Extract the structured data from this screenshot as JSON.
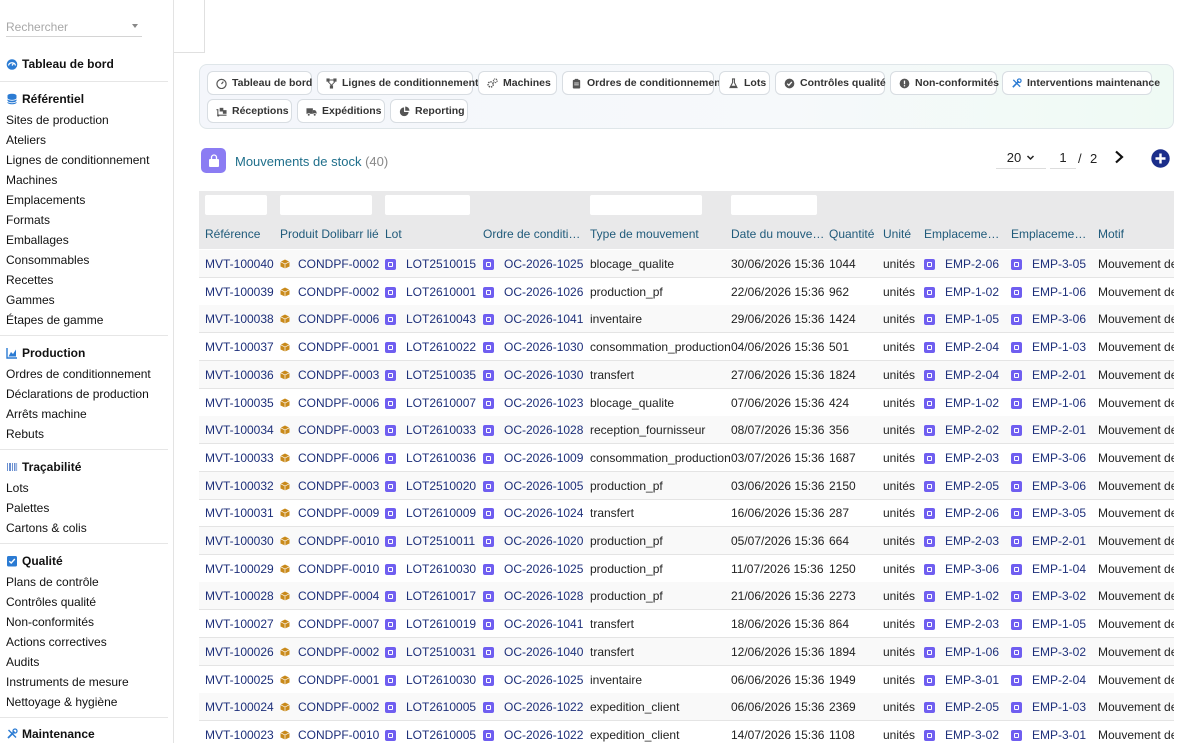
{
  "search": {
    "placeholder": "Rechercher"
  },
  "sidebar": {
    "dashboard": "Tableau de bord",
    "sections": [
      {
        "title": "Référentiel",
        "icon": "database-icon",
        "items": [
          "Sites de production",
          "Ateliers",
          "Lignes de conditionnement",
          "Machines",
          "Emplacements",
          "Formats",
          "Emballages",
          "Consommables",
          "Recettes",
          "Gammes",
          "Étapes de gamme"
        ]
      },
      {
        "title": "Production",
        "icon": "chart-icon",
        "items": [
          "Ordres de conditionnement",
          "Déclarations de production",
          "Arrêts machine",
          "Rebuts"
        ]
      },
      {
        "title": "Traçabilité",
        "icon": "barcode-icon",
        "items": [
          "Lots",
          "Palettes",
          "Cartons & colis"
        ]
      },
      {
        "title": "Qualité",
        "icon": "check-square-icon",
        "items": [
          "Plans de contrôle",
          "Contrôles qualité",
          "Non-conformités",
          "Actions correctives",
          "Audits",
          "Instruments de mesure",
          "Nettoyage & hygiène"
        ]
      },
      {
        "title": "Maintenance",
        "icon": "tools-icon",
        "items": []
      }
    ]
  },
  "tabs": [
    {
      "label": "Tableau de bord",
      "icon": "dashboard-icon"
    },
    {
      "label": "Lignes de conditionnement",
      "icon": "network-icon"
    },
    {
      "label": "Machines",
      "icon": "cogs-icon"
    },
    {
      "label": "Ordres de conditionnement",
      "icon": "clipboard-icon"
    },
    {
      "label": "Lots",
      "icon": "flask-icon"
    },
    {
      "label": "Contrôles qualité",
      "icon": "check-circle-icon"
    },
    {
      "label": "Non-conformités",
      "icon": "exclamation-circle-icon"
    },
    {
      "label": "Interventions maintenance",
      "icon": "tools-icon"
    },
    {
      "label": "Réceptions",
      "icon": "dolly-icon"
    },
    {
      "label": "Expéditions",
      "icon": "truck-icon"
    },
    {
      "label": "Reporting",
      "icon": "pie-chart-icon"
    }
  ],
  "list": {
    "title": "Mouvements de stock",
    "count": "(40)",
    "page_size": "20",
    "page": "1",
    "page_sep": "/",
    "page_total": "2"
  },
  "table": {
    "columns": [
      "Référence",
      "Produit Dolibarr lié",
      "Lot",
      "Ordre de conditi…",
      "Type de mouvement",
      "Date du mouve…",
      "Quantité",
      "Unité",
      "Emplaceme…",
      "Emplaceme…",
      "Motif"
    ],
    "rows": [
      [
        "MVT-100040",
        "CONDPF-0002",
        "LOT2510015",
        "OC-2026-1025",
        "blocage_qualite",
        "30/06/2026 15:36",
        "1044",
        "unités",
        "EMP-2-06",
        "EMP-3-05",
        "Mouvement de"
      ],
      [
        "MVT-100039",
        "CONDPF-0002",
        "LOT2610001",
        "OC-2026-1026",
        "production_pf",
        "22/06/2026 15:36",
        "962",
        "unités",
        "EMP-1-02",
        "EMP-1-06",
        "Mouvement de"
      ],
      [
        "MVT-100038",
        "CONDPF-0006",
        "LOT2610043",
        "OC-2026-1041",
        "inventaire",
        "29/06/2026 15:36",
        "1424",
        "unités",
        "EMP-1-05",
        "EMP-3-06",
        "Mouvement de"
      ],
      [
        "MVT-100037",
        "CONDPF-0001",
        "LOT2610022",
        "OC-2026-1030",
        "consommation_production",
        "04/06/2026 15:36",
        "501",
        "unités",
        "EMP-2-04",
        "EMP-1-03",
        "Mouvement de"
      ],
      [
        "MVT-100036",
        "CONDPF-0003",
        "LOT2510035",
        "OC-2026-1030",
        "transfert",
        "27/06/2026 15:36",
        "1824",
        "unités",
        "EMP-2-04",
        "EMP-2-01",
        "Mouvement de"
      ],
      [
        "MVT-100035",
        "CONDPF-0006",
        "LOT2610007",
        "OC-2026-1023",
        "blocage_qualite",
        "07/06/2026 15:36",
        "424",
        "unités",
        "EMP-1-02",
        "EMP-1-06",
        "Mouvement de"
      ],
      [
        "MVT-100034",
        "CONDPF-0003",
        "LOT2610033",
        "OC-2026-1028",
        "reception_fournisseur",
        "08/07/2026 15:36",
        "356",
        "unités",
        "EMP-2-02",
        "EMP-2-01",
        "Mouvement de"
      ],
      [
        "MVT-100033",
        "CONDPF-0006",
        "LOT2610036",
        "OC-2026-1009",
        "consommation_production",
        "03/07/2026 15:36",
        "1687",
        "unités",
        "EMP-2-03",
        "EMP-3-06",
        "Mouvement de"
      ],
      [
        "MVT-100032",
        "CONDPF-0003",
        "LOT2510020",
        "OC-2026-1005",
        "production_pf",
        "03/06/2026 15:36",
        "2150",
        "unités",
        "EMP-2-05",
        "EMP-3-06",
        "Mouvement de"
      ],
      [
        "MVT-100031",
        "CONDPF-0009",
        "LOT2610009",
        "OC-2026-1024",
        "transfert",
        "16/06/2026 15:36",
        "287",
        "unités",
        "EMP-2-06",
        "EMP-3-05",
        "Mouvement de"
      ],
      [
        "MVT-100030",
        "CONDPF-0010",
        "LOT2510011",
        "OC-2026-1020",
        "production_pf",
        "05/07/2026 15:36",
        "664",
        "unités",
        "EMP-2-03",
        "EMP-2-01",
        "Mouvement de"
      ],
      [
        "MVT-100029",
        "CONDPF-0010",
        "LOT2610030",
        "OC-2026-1025",
        "production_pf",
        "11/07/2026 15:36",
        "1250",
        "unités",
        "EMP-3-06",
        "EMP-1-04",
        "Mouvement de"
      ],
      [
        "MVT-100028",
        "CONDPF-0004",
        "LOT2610017",
        "OC-2026-1028",
        "production_pf",
        "21/06/2026 15:36",
        "2273",
        "unités",
        "EMP-1-02",
        "EMP-3-02",
        "Mouvement de"
      ],
      [
        "MVT-100027",
        "CONDPF-0007",
        "LOT2610019",
        "OC-2026-1041",
        "transfert",
        "18/06/2026 15:36",
        "864",
        "unités",
        "EMP-2-03",
        "EMP-1-05",
        "Mouvement de"
      ],
      [
        "MVT-100026",
        "CONDPF-0002",
        "LOT2510031",
        "OC-2026-1040",
        "transfert",
        "12/06/2026 15:36",
        "1894",
        "unités",
        "EMP-1-06",
        "EMP-3-02",
        "Mouvement de"
      ],
      [
        "MVT-100025",
        "CONDPF-0001",
        "LOT2610030",
        "OC-2026-1025",
        "inventaire",
        "06/06/2026 15:36",
        "1949",
        "unités",
        "EMP-3-01",
        "EMP-2-04",
        "Mouvement de"
      ],
      [
        "MVT-100024",
        "CONDPF-0002",
        "LOT2610005",
        "OC-2026-1022",
        "expedition_client",
        "06/06/2026 15:36",
        "2369",
        "unités",
        "EMP-2-05",
        "EMP-1-03",
        "Mouvement de"
      ],
      [
        "MVT-100023",
        "CONDPF-0010",
        "LOT2610005",
        "OC-2026-1022",
        "expedition_client",
        "14/07/2026 15:36",
        "1108",
        "unités",
        "EMP-3-02",
        "EMP-3-01",
        "Mouvement de"
      ]
    ]
  },
  "colors": {
    "link": "#1d2f7a",
    "header_text": "#1f5a7a",
    "title": "#1f6f8b",
    "accent_purple": "#8b7cf3",
    "lot_icon": "#6f5ef0",
    "product_icon": "#c98a1b"
  }
}
